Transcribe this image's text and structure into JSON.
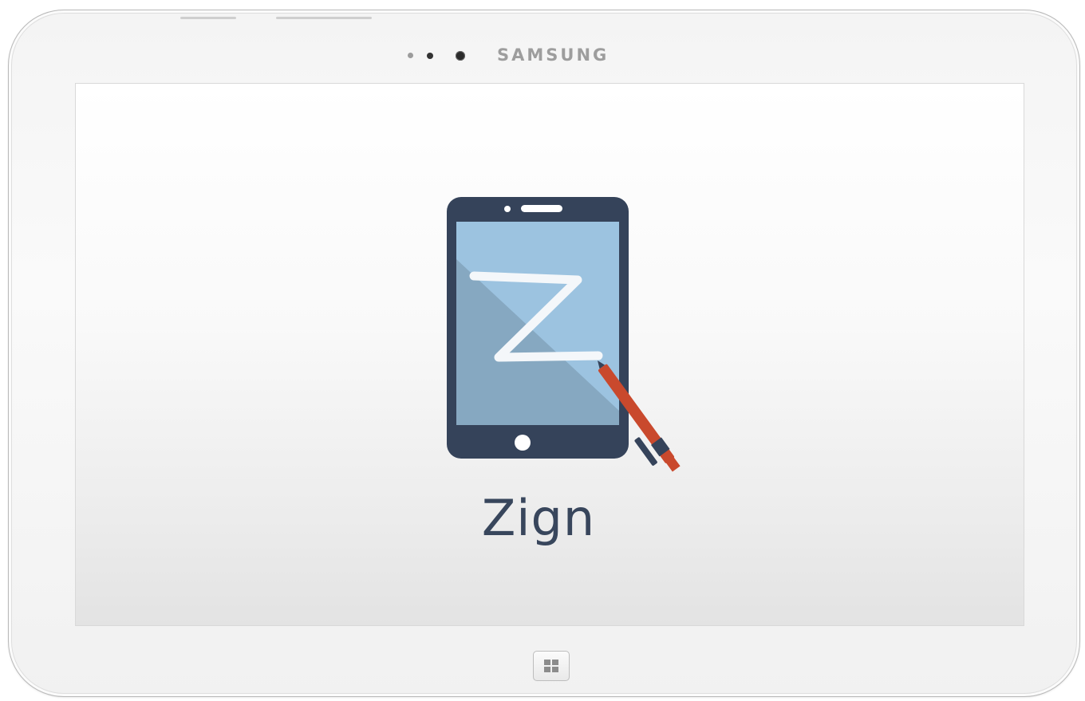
{
  "device": {
    "brand": "SAMSUNG"
  },
  "screen": {
    "app_name": "Zign",
    "logo": {
      "icon": "phone-with-pen-signature-icon",
      "letter": "Z",
      "colors": {
        "phone_body": "#35435a",
        "screen_light": "#9cc3e0",
        "screen_dark": "#86a8c1",
        "pen": "#c9492d",
        "signature": "#f4f7fa"
      }
    }
  },
  "hardware": {
    "home_icon": "windows-icon"
  }
}
